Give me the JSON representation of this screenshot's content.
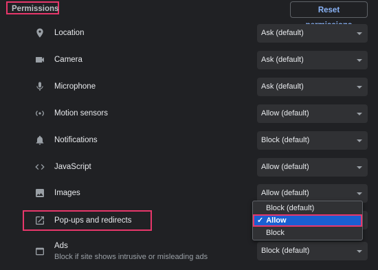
{
  "header": {
    "title": "Permissions",
    "reset_label": "Reset permissions"
  },
  "rows": [
    {
      "label": "Location",
      "icon": "location-pin-icon",
      "value": "Ask (default)"
    },
    {
      "label": "Camera",
      "icon": "camera-icon",
      "value": "Ask (default)"
    },
    {
      "label": "Microphone",
      "icon": "microphone-icon",
      "value": "Ask (default)"
    },
    {
      "label": "Motion sensors",
      "icon": "motion-sensors-icon",
      "value": "Allow (default)"
    },
    {
      "label": "Notifications",
      "icon": "bell-icon",
      "value": "Block (default)"
    },
    {
      "label": "JavaScript",
      "icon": "code-brackets-icon",
      "value": "Allow (default)"
    },
    {
      "label": "Images",
      "icon": "image-icon",
      "value": "Allow (default)"
    },
    {
      "label": "Pop-ups and redirects",
      "icon": "open-in-new-icon",
      "value": "Allow"
    },
    {
      "label": "Ads",
      "sublabel": "Block if site shows intrusive or misleading ads",
      "icon": "ads-window-icon",
      "value": "Block (default)"
    }
  ],
  "popup_dropdown": {
    "options": [
      "Block (default)",
      "Allow",
      "Block"
    ],
    "selected": "Allow",
    "check": "✓"
  },
  "colors": {
    "background": "#202124",
    "highlight": "#e8376b",
    "accent": "#8ab4f8",
    "selected_option": "#1a5fd1"
  }
}
